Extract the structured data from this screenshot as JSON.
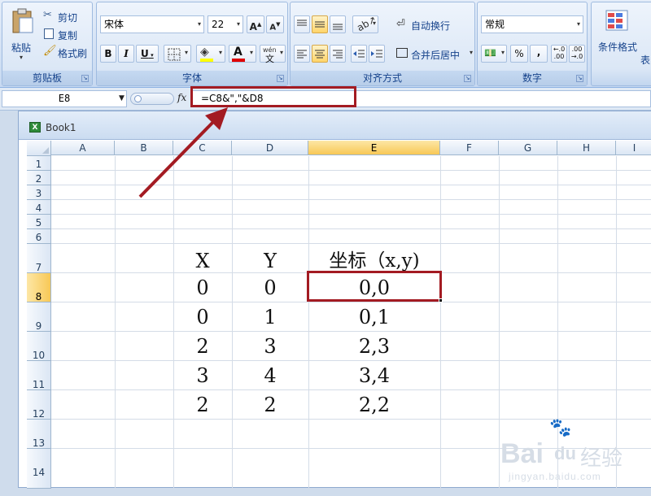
{
  "ribbon": {
    "clipboard": {
      "paste_label": "粘贴",
      "cut_label": "剪切",
      "copy_label": "复制",
      "format_painter_label": "格式刷",
      "group_label": "剪贴板"
    },
    "font": {
      "font_name": "宋体",
      "font_size": "22",
      "bold": "B",
      "italic": "I",
      "underline": "U",
      "pinyin_label": "wén",
      "group_label": "字体"
    },
    "alignment": {
      "wrap_text_label": "自动换行",
      "merge_center_label": "合并后居中",
      "group_label": "对齐方式"
    },
    "number": {
      "format_value": "常规",
      "percent": "%",
      "comma": ",",
      "group_label": "数字"
    },
    "styles": {
      "conditional_format_label": "条件格式",
      "table_label": "表"
    }
  },
  "formula_bar": {
    "name_box": "E8",
    "fx_label": "fx",
    "formula": "=C8&\",\"&D8"
  },
  "workbook": {
    "title": "Book1",
    "columns": [
      "A",
      "B",
      "C",
      "D",
      "E",
      "F",
      "G",
      "H",
      "I"
    ],
    "rows": [
      "1",
      "2",
      "3",
      "4",
      "5",
      "6",
      "7",
      "8",
      "9",
      "10",
      "11",
      "12",
      "13",
      "14"
    ],
    "selected_column": "E",
    "selected_row": "8",
    "cells": {
      "C7": "X",
      "D7": "Y",
      "E7": "坐标（x,y)",
      "C8": "0",
      "D8": "0",
      "E8": "0,0",
      "C9": "0",
      "D9": "1",
      "E9": "0,1",
      "C10": "2",
      "D10": "3",
      "E10": "2,3",
      "C11": "3",
      "D11": "4",
      "E11": "3,4",
      "C12": "2",
      "D12": "2",
      "E12": "2,2"
    }
  },
  "annotation": {
    "color": "#a31b22"
  },
  "watermark": {
    "brand": "Bai",
    "paw": "du",
    "cn": "经验",
    "url": "jingyan.baidu.com"
  }
}
